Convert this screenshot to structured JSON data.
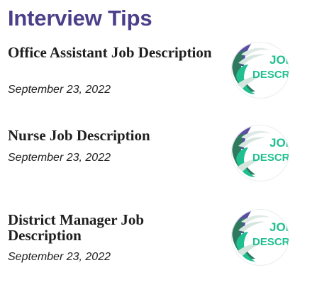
{
  "section": {
    "title": "Interview Tips"
  },
  "articles": [
    {
      "title": "Office Assistant Job Description",
      "date": "September 23, 2022",
      "thumbnail": {
        "line1": "JOB",
        "line2": "DESCRIPTION"
      }
    },
    {
      "title": "Nurse Job Description",
      "date": "September 23, 2022",
      "thumbnail": {
        "line1": "JOB",
        "line2": "DESCRIPTION"
      }
    },
    {
      "title": "District Manager Job Description",
      "date": "September 23, 2022",
      "thumbnail": {
        "line1": "JOB",
        "line2": "DESCRIPTION"
      }
    }
  ],
  "colors": {
    "title": "#4b3f8a",
    "thumb_teal": "#1fbf8f",
    "thumb_purple": "#5a4ea3",
    "thumb_green": "#2f7a5f"
  }
}
